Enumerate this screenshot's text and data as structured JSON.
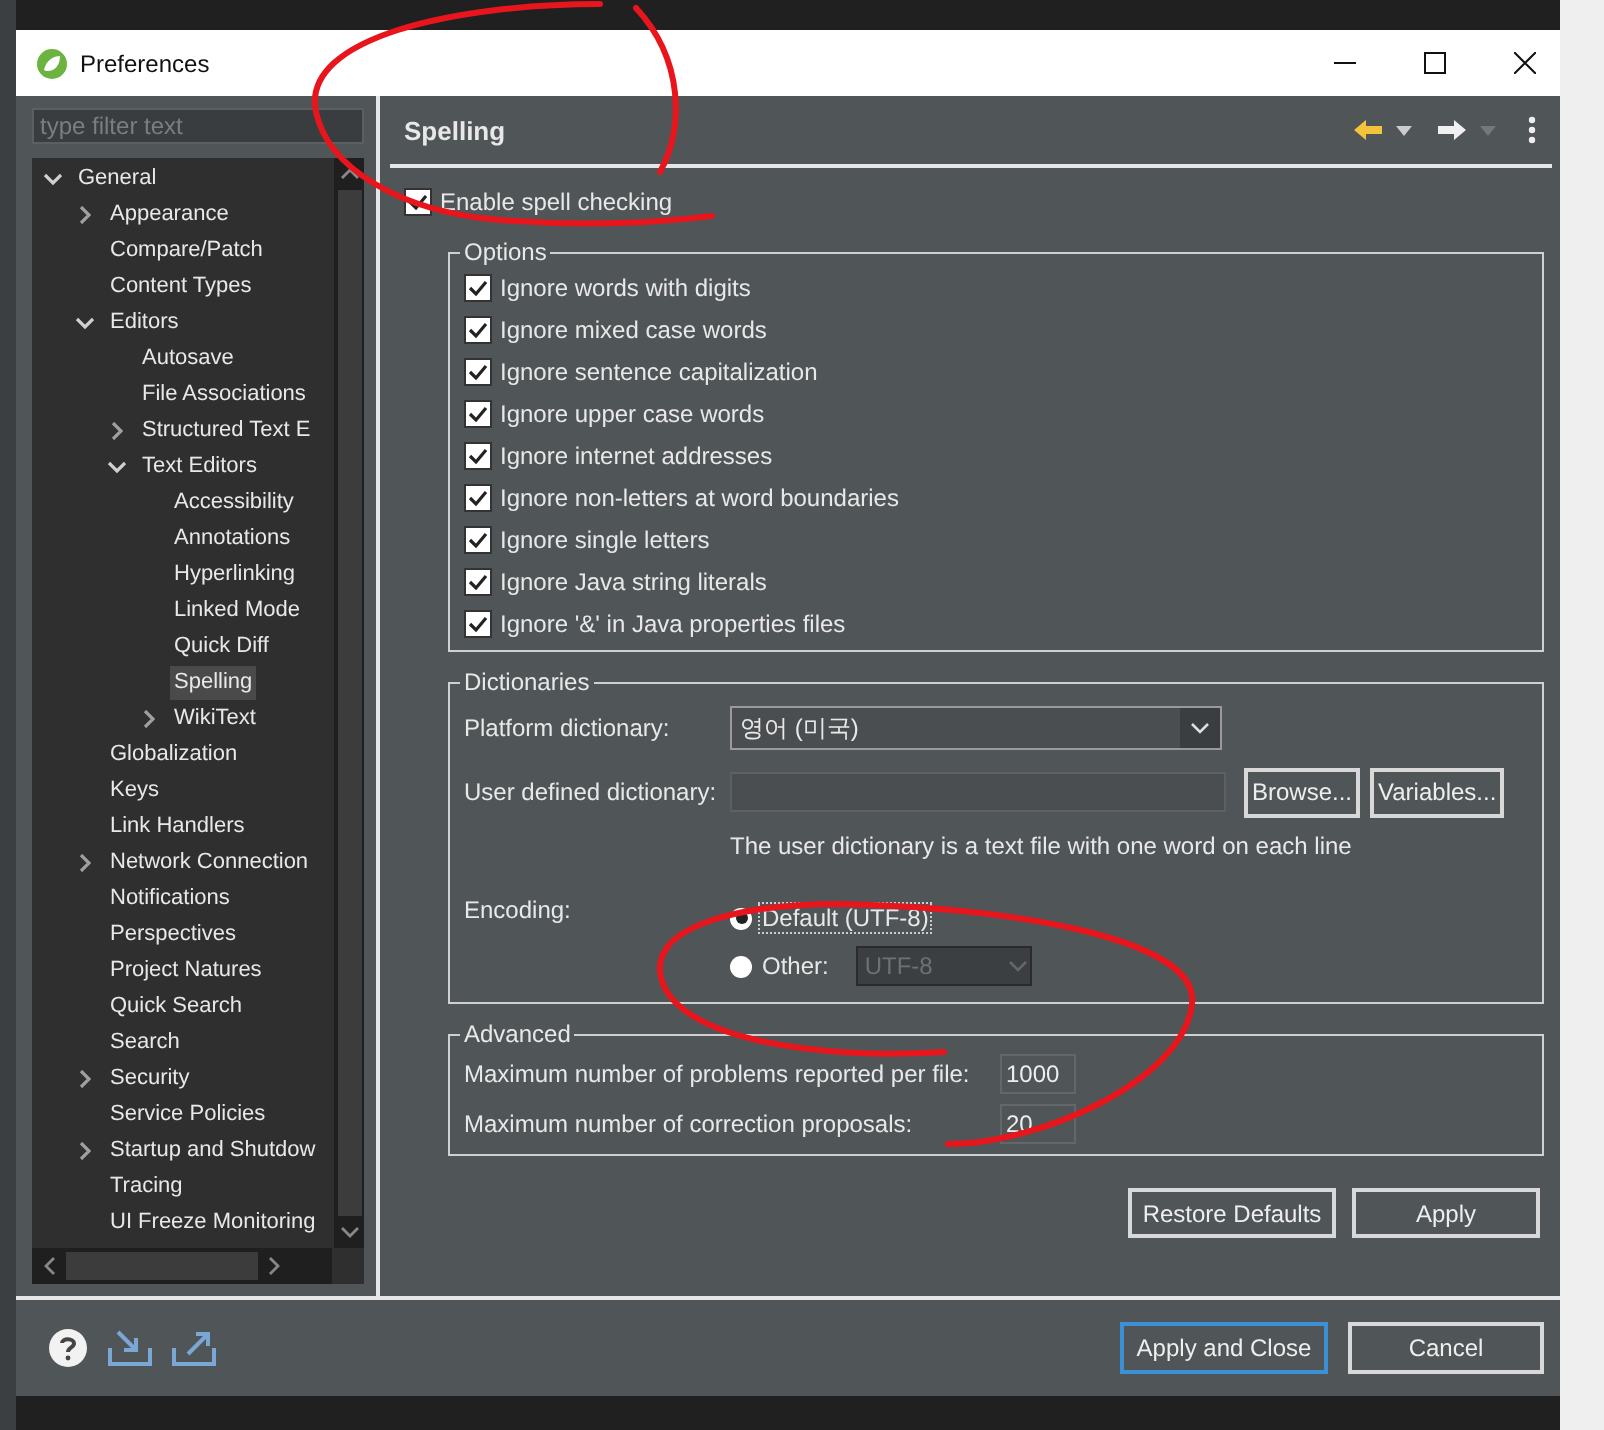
{
  "window": {
    "title": "Preferences"
  },
  "filter": {
    "placeholder": "type filter text"
  },
  "tree": [
    {
      "label": "General",
      "expanded": true,
      "selected": false,
      "children": [
        {
          "label": "Appearance",
          "expanded": false,
          "selected": false
        },
        {
          "label": "Compare/Patch",
          "selected": false
        },
        {
          "label": "Content Types",
          "selected": false
        },
        {
          "label": "Editors",
          "expanded": true,
          "selected": false,
          "children": [
            {
              "label": "Autosave",
              "selected": false
            },
            {
              "label": "File Associations",
              "selected": false
            },
            {
              "label": "Structured Text E",
              "expanded": false,
              "selected": false
            },
            {
              "label": "Text Editors",
              "expanded": true,
              "selected": false,
              "children": [
                {
                  "label": "Accessibility",
                  "selected": false
                },
                {
                  "label": "Annotations",
                  "selected": false
                },
                {
                  "label": "Hyperlinking",
                  "selected": false
                },
                {
                  "label": "Linked Mode",
                  "selected": false
                },
                {
                  "label": "Quick Diff",
                  "selected": false
                },
                {
                  "label": "Spelling",
                  "selected": true
                },
                {
                  "label": "WikiText",
                  "expanded": false,
                  "selected": false
                }
              ]
            }
          ]
        },
        {
          "label": "Globalization",
          "selected": false
        },
        {
          "label": "Keys",
          "selected": false
        },
        {
          "label": "Link Handlers",
          "selected": false
        },
        {
          "label": "Network Connection",
          "expanded": false,
          "selected": false
        },
        {
          "label": "Notifications",
          "selected": false
        },
        {
          "label": "Perspectives",
          "selected": false
        },
        {
          "label": "Project Natures",
          "selected": false
        },
        {
          "label": "Quick Search",
          "selected": false
        },
        {
          "label": "Search",
          "selected": false
        },
        {
          "label": "Security",
          "expanded": false,
          "selected": false
        },
        {
          "label": "Service Policies",
          "selected": false
        },
        {
          "label": "Startup and Shutdow",
          "expanded": false,
          "selected": false
        },
        {
          "label": "Tracing",
          "selected": false
        },
        {
          "label": "UI Freeze Monitoring",
          "selected": false
        }
      ]
    }
  ],
  "page": {
    "title": "Spelling",
    "enable": {
      "label": "Enable spell checking",
      "checked": true
    },
    "options": {
      "title": "Options",
      "items": [
        {
          "label": "Ignore words with digits",
          "checked": true
        },
        {
          "label": "Ignore mixed case words",
          "checked": true
        },
        {
          "label": "Ignore sentence capitalization",
          "checked": true
        },
        {
          "label": "Ignore upper case words",
          "checked": true
        },
        {
          "label": "Ignore internet addresses",
          "checked": true
        },
        {
          "label": "Ignore non-letters at word boundaries",
          "checked": true
        },
        {
          "label": "Ignore single letters",
          "checked": true
        },
        {
          "label": "Ignore Java string literals",
          "checked": true
        },
        {
          "label": "Ignore '&' in Java properties files",
          "checked": true
        }
      ]
    },
    "dictionaries": {
      "title": "Dictionaries",
      "platform_label": "Platform dictionary:",
      "platform_value": "영어 (미국)",
      "user_label": "User defined dictionary:",
      "browse": "Browse...",
      "variables": "Variables...",
      "hint": "The user dictionary is a text file with one word on each line",
      "encoding_label": "Encoding:",
      "encoding_options": [
        {
          "label": "Default (UTF-8)",
          "selected": true
        },
        {
          "label": "Other:",
          "selected": false
        }
      ],
      "other_value": "UTF-8"
    },
    "advanced": {
      "title": "Advanced",
      "fields": [
        {
          "label": "Maximum number of problems reported per file:",
          "value": "1000"
        },
        {
          "label": "Maximum number of correction proposals:",
          "value": "20"
        }
      ]
    },
    "buttons": [
      "Restore Defaults",
      "Apply"
    ]
  },
  "footer": {
    "buttons": [
      {
        "label": "Apply and Close",
        "default": true
      },
      {
        "label": "Cancel",
        "default": false
      }
    ]
  }
}
